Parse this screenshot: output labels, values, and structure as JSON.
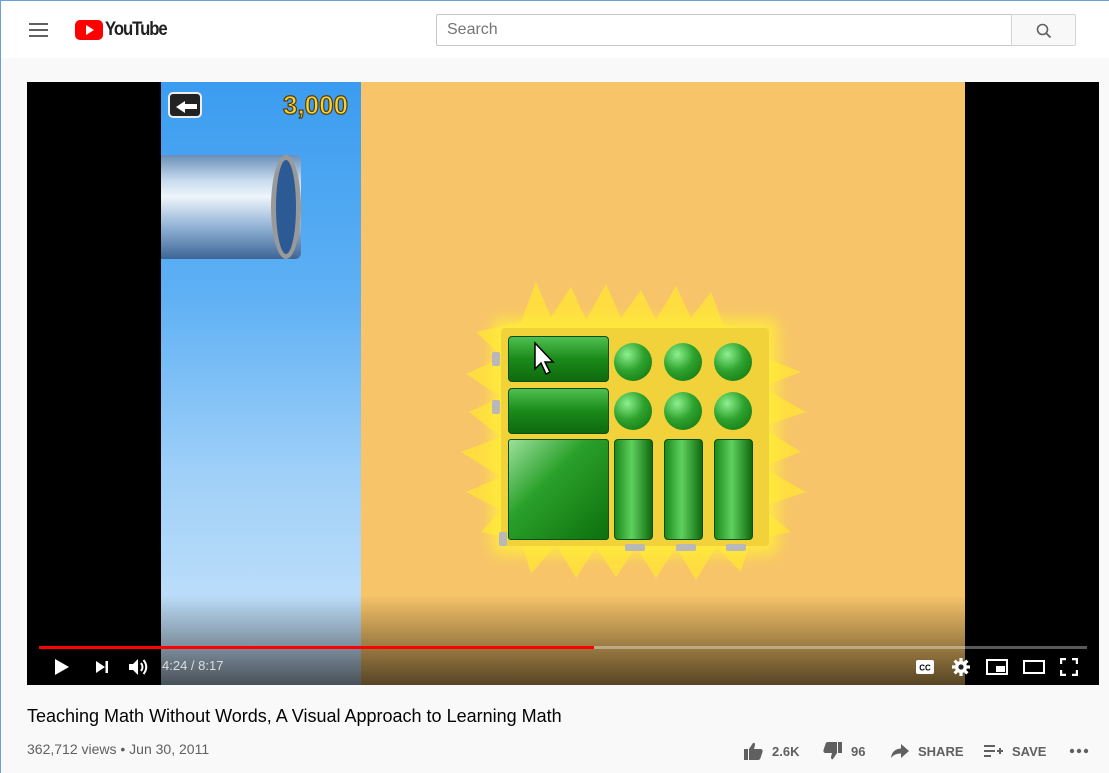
{
  "header": {
    "logo_text": "YouTube",
    "search_placeholder": "Search"
  },
  "player": {
    "game_score": "3,000",
    "current_time": "4:24",
    "duration": "8:17",
    "time_display": "4:24 / 8:17",
    "progress_fraction": 0.53
  },
  "video": {
    "title": "Teaching Math Without Words, A Visual Approach to Learning Math",
    "views": "362,712 views",
    "date": "Jun 30, 2011",
    "meta_line": "362,712 views • Jun 30, 2011",
    "likes": "2.6K",
    "dislikes": "96",
    "share_label": "SHARE",
    "save_label": "SAVE"
  },
  "colors": {
    "brand_red": "#ff0000",
    "progress": "#ff0000"
  }
}
